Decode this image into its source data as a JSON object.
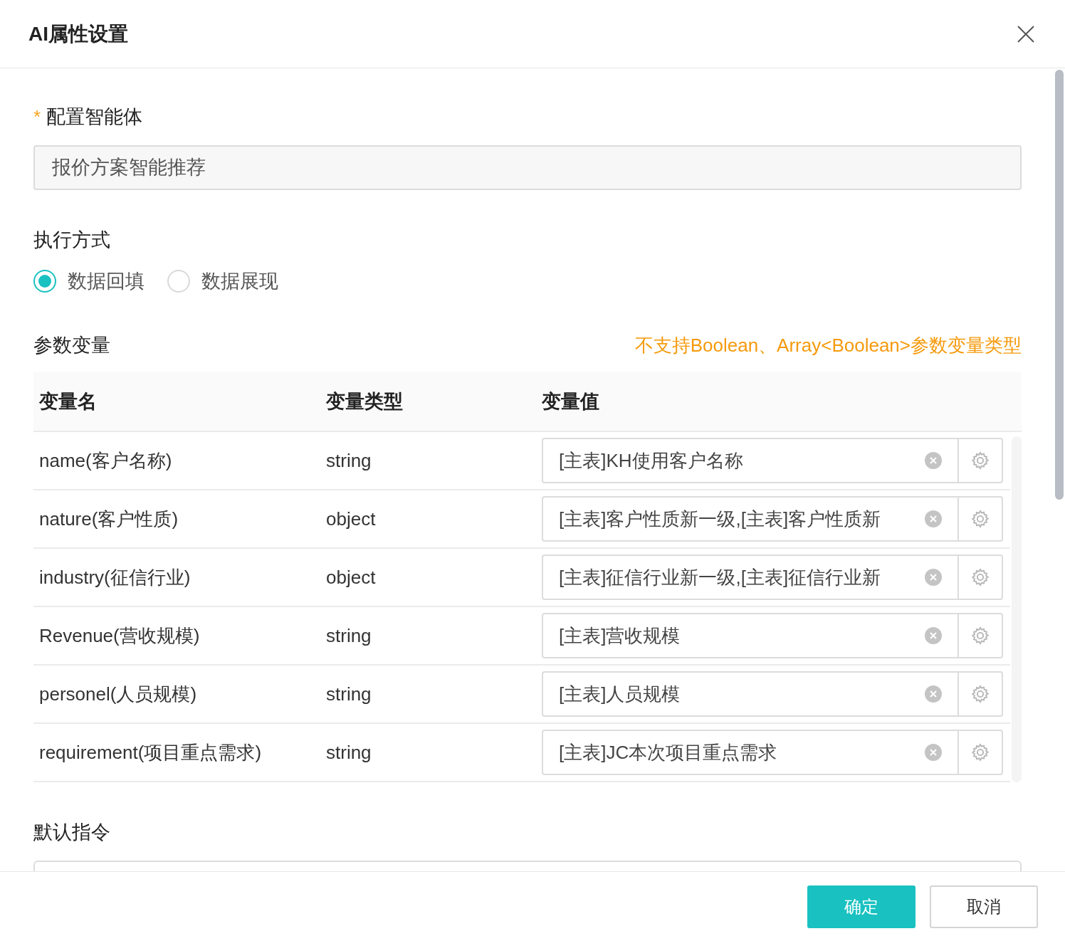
{
  "title": "AI属性设置",
  "agent": {
    "label": "配置智能体",
    "required_mark": "*",
    "value": "报价方案智能推荐"
  },
  "execution": {
    "label": "执行方式",
    "options": [
      {
        "label": "数据回填",
        "selected": true
      },
      {
        "label": "数据展现",
        "selected": false
      }
    ]
  },
  "params": {
    "label": "参数变量",
    "warning": "不支持Boolean、Array<Boolean>参数变量类型",
    "columns": [
      "变量名",
      "变量类型",
      "变量值"
    ],
    "rows": [
      {
        "name": "name(客户名称)",
        "type": "string",
        "value": "[主表]KH使用客户名称"
      },
      {
        "name": "nature(客户性质)",
        "type": "object",
        "value": "[主表]客户性质新一级,[主表]客户性质新"
      },
      {
        "name": "industry(征信行业)",
        "type": "object",
        "value": "[主表]征信行业新一级,[主表]征信行业新"
      },
      {
        "name": "Revenue(营收规模)",
        "type": "string",
        "value": "[主表]营收规模"
      },
      {
        "name": "personel(人员规模)",
        "type": "string",
        "value": "[主表]人员规模"
      },
      {
        "name": "requirement(项目重点需求)",
        "type": "string",
        "value": "[主表]JC本次项目重点需求"
      }
    ]
  },
  "default_instruction": {
    "label": "默认指令"
  },
  "buttons": [
    {
      "label": "确定",
      "kind": "primary"
    },
    {
      "label": "取消",
      "kind": "default"
    }
  ]
}
